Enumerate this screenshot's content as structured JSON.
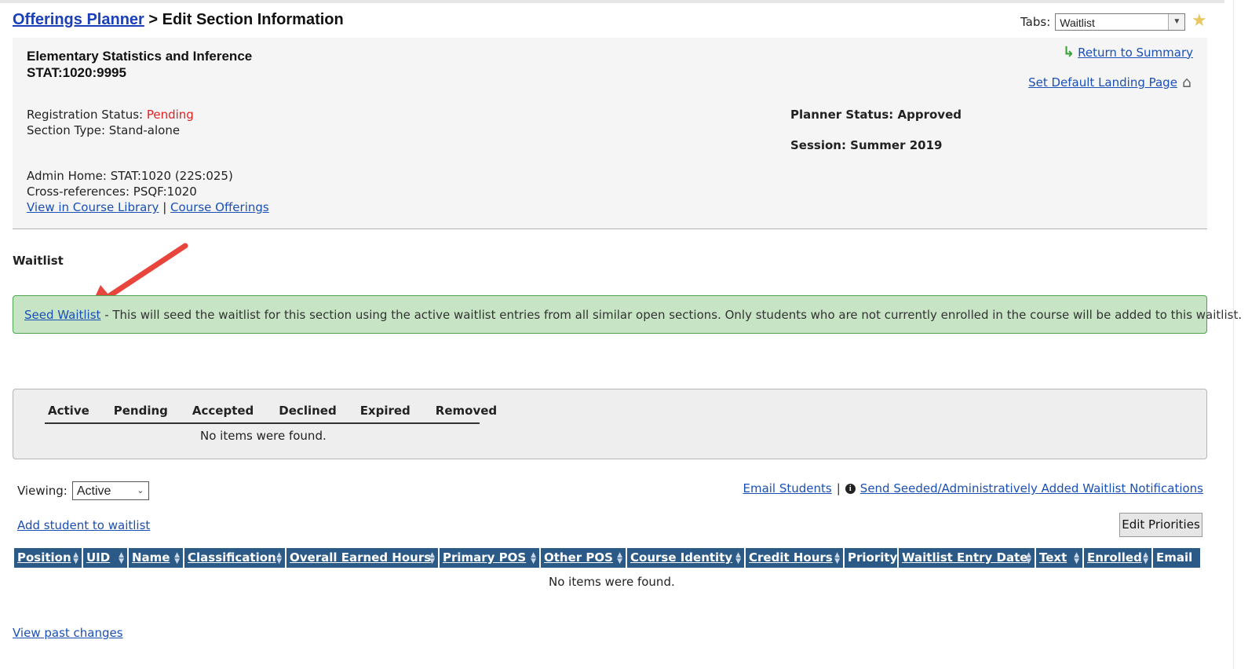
{
  "breadcrumb": {
    "root_link": "Offerings Planner",
    "separator": ">",
    "current": "Edit Section Information"
  },
  "tabs": {
    "label": "Tabs:",
    "selected": "Waitlist"
  },
  "course": {
    "name": "Elementary Statistics and Inference",
    "code": "STAT:1020:9995",
    "registration_status_label": "Registration Status:",
    "registration_status_value": "Pending",
    "section_type": "Section Type: Stand-alone",
    "admin_home": "Admin Home: STAT:1020 (22S:025)",
    "cross_references": "Cross-references: PSQF:1020",
    "view_library_link": "View in Course Library",
    "link_separator": "|",
    "course_offerings_link": "Course Offerings",
    "planner_status": "Planner Status: Approved",
    "session": "Session: Summer 2019",
    "return_link": "Return to Summary",
    "landing_link": "Set Default Landing Page"
  },
  "waitlist": {
    "heading": "Waitlist",
    "seed_link": "Seed Waitlist",
    "seed_text": " - This will seed the waitlist for this section using the active waitlist entries from all similar open sections. Only students who are not currently enrolled in the course will be added to this waitlist."
  },
  "status_tabs": [
    "Active",
    "Pending",
    "Accepted",
    "Declined",
    "Expired",
    "Removed"
  ],
  "status_empty": "No items were found.",
  "viewing": {
    "label": "Viewing:",
    "selected": "Active"
  },
  "email_students": "Email Students",
  "email_sep": "|",
  "send_notifications": "Send Seeded/Administratively Added Waitlist Notifications",
  "add_student": "Add student to waitlist",
  "edit_priorities": "Edit Priorities",
  "grid_columns": [
    {
      "label": "Position",
      "sortable": true
    },
    {
      "label": "UID",
      "sortable": true
    },
    {
      "label": "Name",
      "sortable": true
    },
    {
      "label": "Classification",
      "sortable": true
    },
    {
      "label": "Overall Earned Hours",
      "sortable": true
    },
    {
      "label": "Primary POS",
      "sortable": true
    },
    {
      "label": "Other POS",
      "sortable": true
    },
    {
      "label": "Course Identity",
      "sortable": true
    },
    {
      "label": "Credit Hours",
      "sortable": true
    },
    {
      "label": "Priority",
      "sortable": false
    },
    {
      "label": "Waitlist Entry Date",
      "sortable": true
    },
    {
      "label": "Text",
      "sortable": true
    },
    {
      "label": "Enrolled",
      "sortable": true
    },
    {
      "label": "Email",
      "sortable": false
    }
  ],
  "grid_empty": "No items were found.",
  "past_changes": "View past changes"
}
